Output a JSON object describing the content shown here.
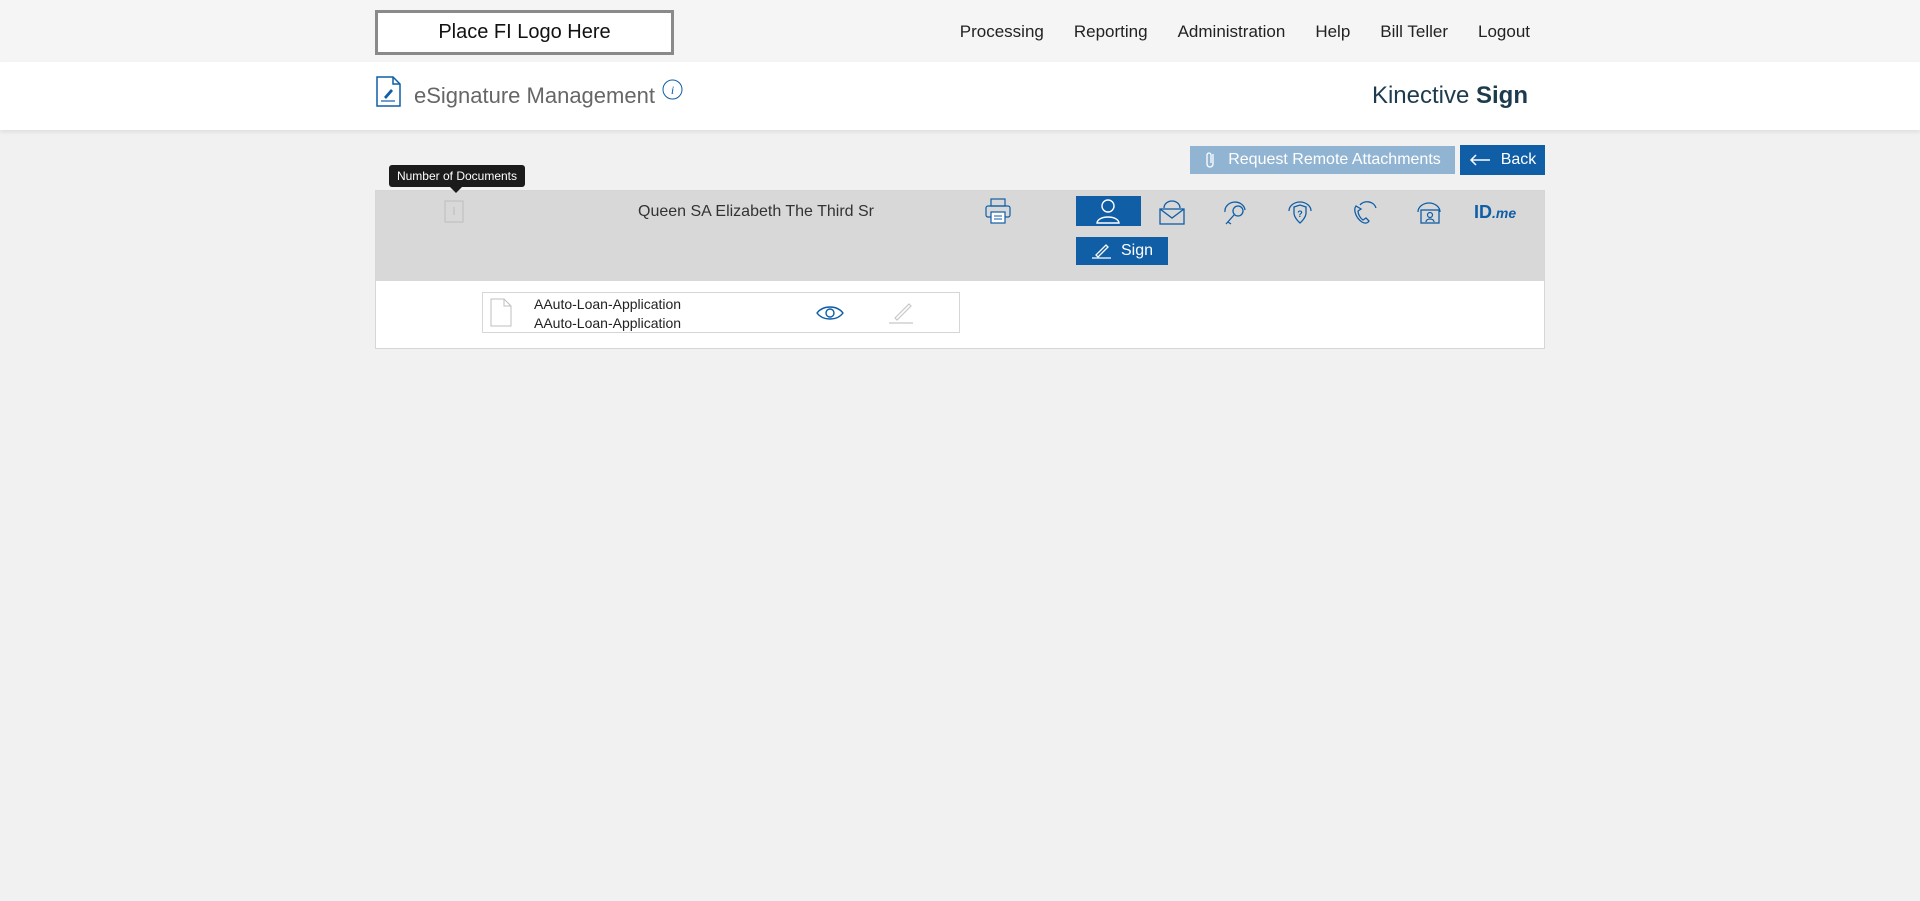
{
  "topbar": {
    "logo_text": "Place FI Logo Here",
    "nav": [
      "Processing",
      "Reporting",
      "Administration",
      "Help",
      "Bill Teller",
      "Logout"
    ]
  },
  "header": {
    "title": "eSignature Management",
    "brand_regular": "Kinective",
    "brand_bold": "Sign",
    "icons": {
      "app": "document-sign-icon",
      "info": "info-icon"
    }
  },
  "actions": {
    "request_attachments_label": "Request Remote Attachments",
    "back_label": "Back"
  },
  "signer": {
    "tooltip": "Number of Documents",
    "name": "Queen SA Elizabeth The Third Sr",
    "auth_methods": [
      "in-person-icon",
      "email-icon",
      "passcode-icon",
      "kba-icon",
      "phone-icon",
      "remote-id-icon",
      "idme-icon"
    ],
    "idme_text_a": "ID",
    "idme_text_b": ".me",
    "sign_label": "Sign"
  },
  "documents": [
    {
      "name_line1": "AAuto-Loan-Application",
      "name_line2": "AAuto-Loan-Application"
    }
  ],
  "colors": {
    "primary": "#0f5ea6",
    "disabled": "#91b4d2",
    "panel_header": "#d8d8d8",
    "brand": "#1d3b4c"
  }
}
